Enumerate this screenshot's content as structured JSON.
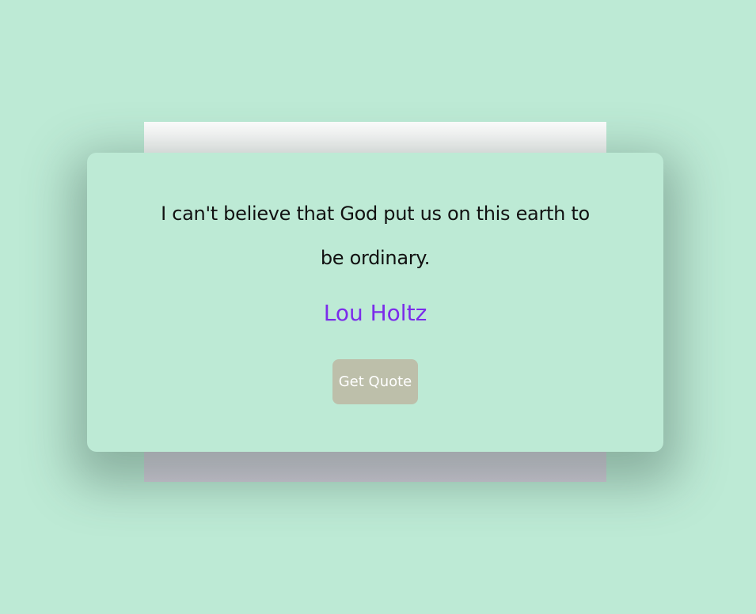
{
  "quote": {
    "text": "I can't believe that God put us on this earth to be ordinary.",
    "author": "Lou Holtz"
  },
  "actions": {
    "get_quote_label": "Get Quote"
  },
  "colors": {
    "background": "#bdead5",
    "author": "#7b2cea",
    "button": "#bdbfaa",
    "button_text": "#ffffff"
  }
}
